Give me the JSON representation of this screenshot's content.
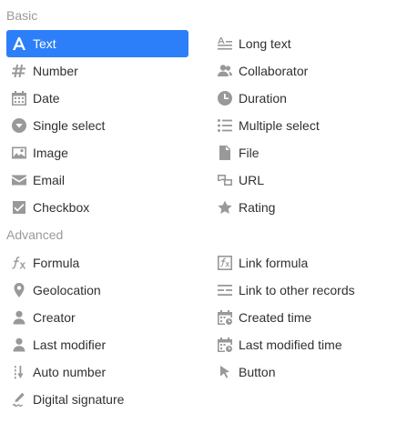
{
  "basic": {
    "title": "Basic",
    "items": [
      {
        "label": "Text",
        "icon": "text-icon",
        "selected": true
      },
      {
        "label": "Long text",
        "icon": "long-text-icon"
      },
      {
        "label": "Number",
        "icon": "number-icon"
      },
      {
        "label": "Collaborator",
        "icon": "collaborator-icon"
      },
      {
        "label": "Date",
        "icon": "date-icon"
      },
      {
        "label": "Duration",
        "icon": "duration-icon"
      },
      {
        "label": "Single select",
        "icon": "single-select-icon"
      },
      {
        "label": "Multiple select",
        "icon": "multiple-select-icon"
      },
      {
        "label": "Image",
        "icon": "image-icon"
      },
      {
        "label": "File",
        "icon": "file-icon"
      },
      {
        "label": "Email",
        "icon": "email-icon"
      },
      {
        "label": "URL",
        "icon": "url-icon"
      },
      {
        "label": "Checkbox",
        "icon": "checkbox-icon"
      },
      {
        "label": "Rating",
        "icon": "rating-icon"
      }
    ]
  },
  "advanced": {
    "title": "Advanced",
    "items": [
      {
        "label": "Formula",
        "icon": "formula-icon"
      },
      {
        "label": "Link formula",
        "icon": "link-formula-icon"
      },
      {
        "label": "Geolocation",
        "icon": "geolocation-icon"
      },
      {
        "label": "Link to other records",
        "icon": "link-records-icon"
      },
      {
        "label": "Creator",
        "icon": "creator-icon"
      },
      {
        "label": "Created time",
        "icon": "created-time-icon"
      },
      {
        "label": "Last modifier",
        "icon": "last-modifier-icon"
      },
      {
        "label": "Last modified time",
        "icon": "last-modified-time-icon"
      },
      {
        "label": "Auto number",
        "icon": "auto-number-icon"
      },
      {
        "label": "Button",
        "icon": "button-icon"
      },
      {
        "label": "Digital signature",
        "icon": "digital-signature-icon"
      }
    ]
  },
  "colors": {
    "selected_bg": "#2d7ff9",
    "icon": "#999999",
    "section_title": "#9a9a9a",
    "text": "#303030"
  }
}
